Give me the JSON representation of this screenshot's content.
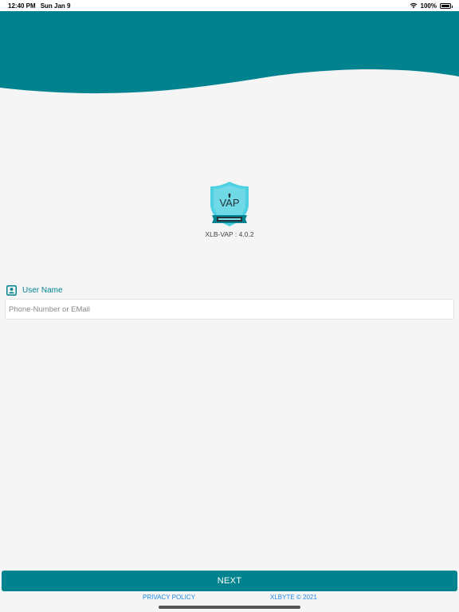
{
  "status_bar": {
    "time": "12:40 PM",
    "date": "Sun Jan 9",
    "battery": "100%",
    "icons": [
      "wifi-icon",
      "battery-icon"
    ]
  },
  "colors": {
    "primary": "#00838f",
    "background": "#f5f5f5",
    "link": "#1e88e5",
    "logo_shield": "#4dd0e1"
  },
  "logo": {
    "text": "VAP",
    "version": "XLB-VAP : 4.0.2"
  },
  "login": {
    "label": "User Name",
    "label_icon": "contact-card-icon",
    "input_value": "",
    "input_placeholder": "Phone-Number or EMail"
  },
  "actions": {
    "next_label": "NEXT"
  },
  "footer": {
    "privacy": "PRIVACY POLICY",
    "copyright": "XLBYTE © 2021"
  }
}
